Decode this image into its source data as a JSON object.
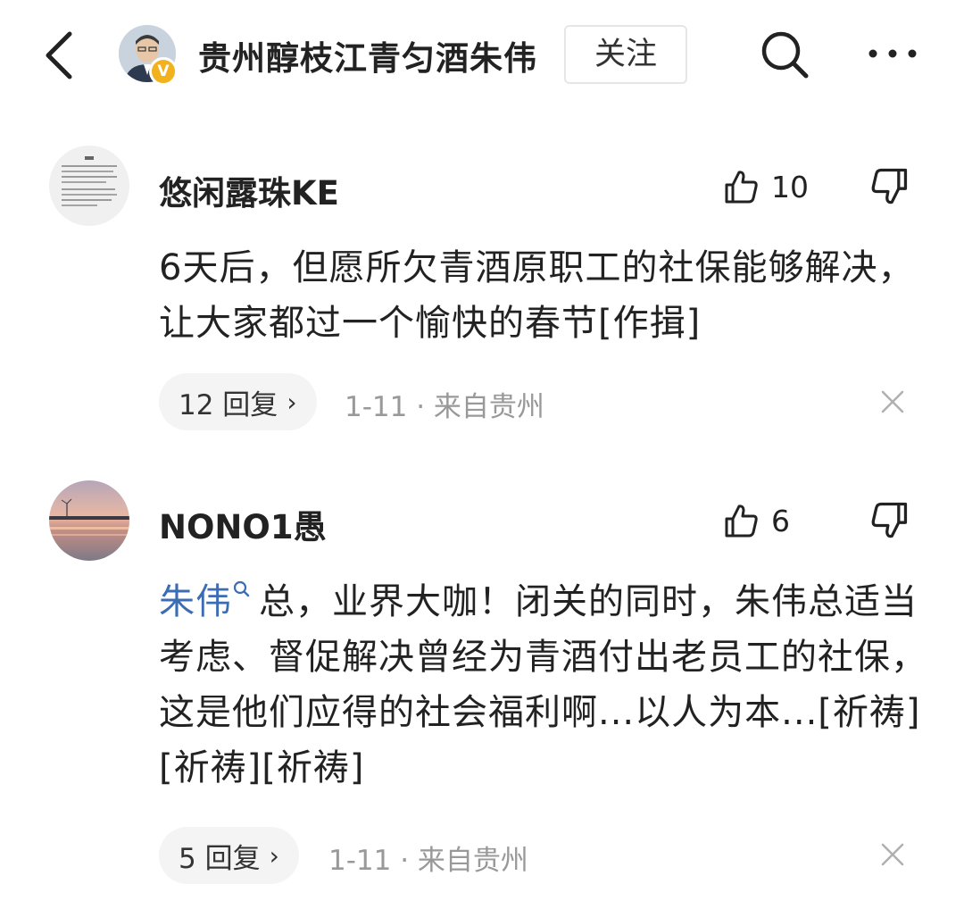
{
  "header": {
    "author_name": "贵州醇枝江青匀酒朱伟",
    "follow_label": "关注",
    "verified_badge": "V",
    "icons": {
      "back": "chevron-left-icon",
      "search": "search-icon",
      "more": "more-horizontal-icon"
    }
  },
  "comments": [
    {
      "username": "悠闲露珠KE",
      "likes": "10",
      "body": "6天后，但愿所欠青酒原职工的社保能够解决，让大家都过一个愉快的春节[作揖]",
      "reply_label": "12 回复",
      "meta": "1-11 · 来自贵州"
    },
    {
      "username": "NONO1愚",
      "likes": "6",
      "mention": "朱伟",
      "body": "总，业界大咖！闭关的同时，朱伟总适当考虑、督促解决曾经为青酒付出老员工的社保，这是他们应得的社会福利啊...以人为本...[祈祷][祈祷][祈祷]",
      "reply_label": "5 回复",
      "meta": "1-11 · 来自贵州"
    }
  ],
  "colors": {
    "mention": "#3b6cb4",
    "verified": "#f2b21d",
    "meta_text": "#999999",
    "pill_bg": "#f4f4f4"
  }
}
